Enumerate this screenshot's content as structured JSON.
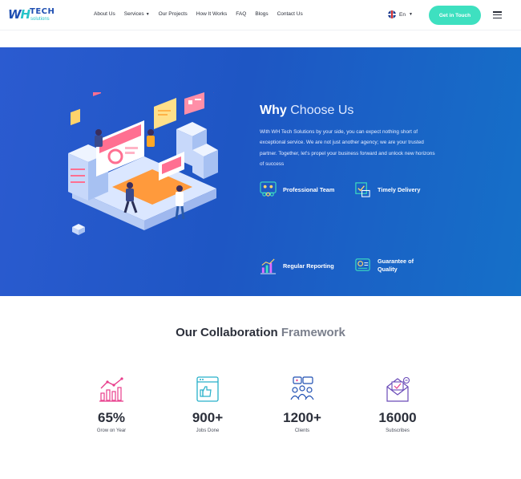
{
  "header": {
    "logo": {
      "brand": "TECH",
      "tagline": "solutions"
    },
    "nav": [
      {
        "label": "About Us"
      },
      {
        "label": "Services",
        "dropdown": true
      },
      {
        "label": "Our Projects"
      },
      {
        "label": "How It Works"
      },
      {
        "label": "FAQ"
      },
      {
        "label": "Blogs"
      },
      {
        "label": "Contact Us"
      }
    ],
    "language": "En",
    "cta": "Get in Touch",
    "menu_icon": "hamburger-icon"
  },
  "why": {
    "title_bold": "Why",
    "title_light": "Choose Us",
    "text": "With WH Tech Solutions by your side, you can expect nothing short of exceptional service. We are not just another agency; we are your trusted partner. Together, let's propel your business forward and unlock new horizons of success",
    "features": [
      {
        "label": "Professional Team",
        "icon": "team-icon"
      },
      {
        "label": "Timely Delivery",
        "icon": "delivery-icon"
      },
      {
        "label": "Regular Reporting",
        "icon": "report-icon"
      },
      {
        "label": "Guarantee of Quality",
        "icon": "quality-icon"
      }
    ]
  },
  "framework": {
    "title_bold": "Our Collaboration",
    "title_light": "Framework",
    "stats": [
      {
        "value": "65%",
        "caption": "Grow on Year",
        "icon": "growth-chart-icon"
      },
      {
        "value": "900+",
        "caption": "Jobs Done",
        "icon": "jobs-board-icon"
      },
      {
        "value": "1200+",
        "caption": "Clients",
        "icon": "clients-icon"
      },
      {
        "value": "16000",
        "caption": "Subscribes",
        "icon": "subscribe-mail-icon"
      }
    ]
  },
  "colors": {
    "primary": "#1f4fb2",
    "accent": "#3ee0c0",
    "hero_bg": "#1e56c4",
    "icon_pink": "#e83e8c",
    "icon_teal": "#27b0c9",
    "icon_blue": "#1f4fb2",
    "icon_purple": "#6a4bb8"
  }
}
